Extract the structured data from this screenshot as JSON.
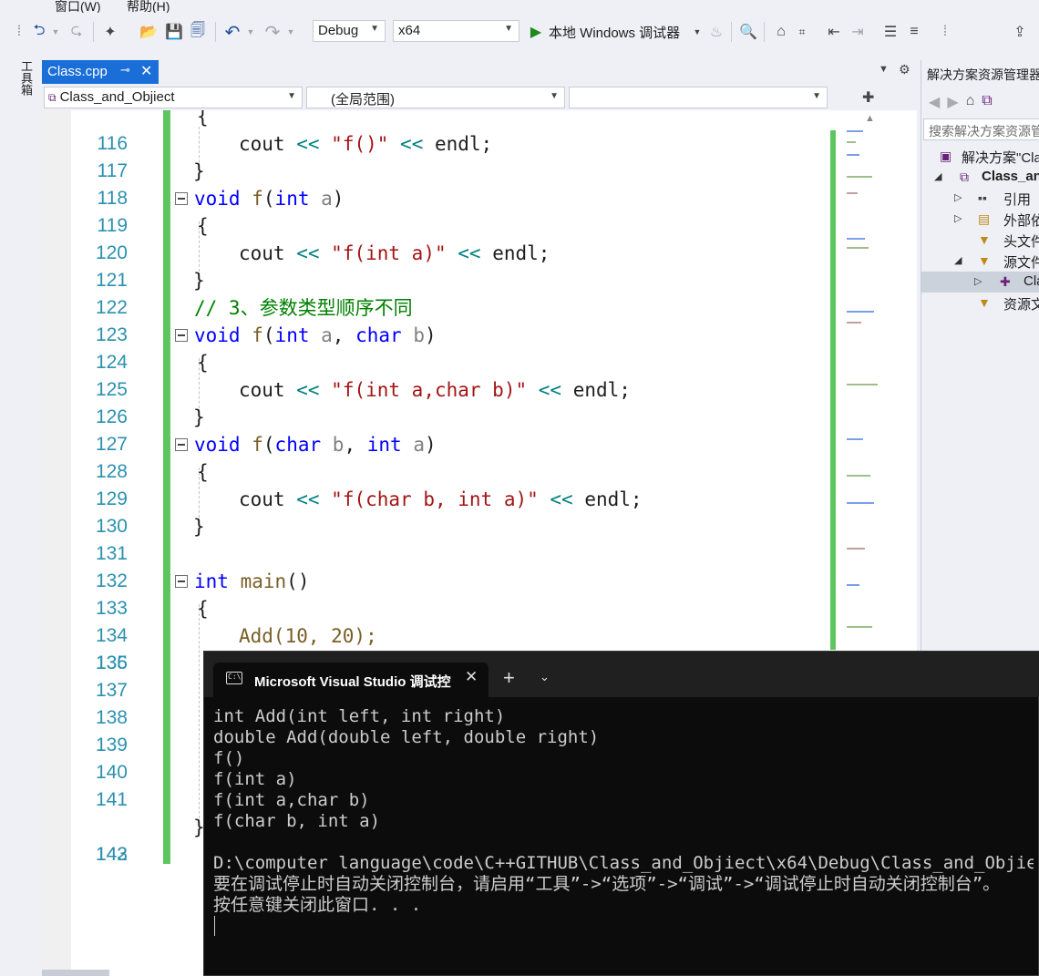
{
  "menubar": {
    "items": [
      "窗口(W)",
      "帮助(H)"
    ]
  },
  "toolbar": {
    "config": "Debug",
    "platform": "x64",
    "run_label": "本地 Windows 调试器"
  },
  "toolbox": {
    "label": "工具箱"
  },
  "tabs": [
    {
      "label": "Class.cpp"
    }
  ],
  "navbar": {
    "project": "Class_and_Objiect",
    "scope": "(全局范围)",
    "member": ""
  },
  "editor": {
    "lines": [
      {
        "n": "116",
        "text": "{"
      },
      {
        "n": "117",
        "text": "cout << \"f()\" << endl;"
      },
      {
        "n": "118",
        "text": "}"
      },
      {
        "n": "119",
        "text": "void f(int a)"
      },
      {
        "n": "120",
        "text": "{"
      },
      {
        "n": "121",
        "text": "cout << \"f(int a)\" << endl;"
      },
      {
        "n": "122",
        "text": "}"
      },
      {
        "n": "123",
        "text": "// 3、参数类型顺序不同"
      },
      {
        "n": "124",
        "text": "void f(int a, char b)"
      },
      {
        "n": "125",
        "text": "{"
      },
      {
        "n": "126",
        "text": "cout << \"f(int a,char b)\" << endl;"
      },
      {
        "n": "127",
        "text": "}"
      },
      {
        "n": "128",
        "text": "void f(char b, int a)"
      },
      {
        "n": "129",
        "text": "{"
      },
      {
        "n": "130",
        "text": "cout << \"f(char b, int a)\" << endl;"
      },
      {
        "n": "131",
        "text": "}"
      },
      {
        "n": "132",
        "text": ""
      },
      {
        "n": "133",
        "text": "int main()"
      },
      {
        "n": "134",
        "text": "{"
      },
      {
        "n": "135",
        "text": "Add(10, 20);"
      },
      {
        "n": "136",
        "text": ""
      },
      {
        "n": "137",
        "text": ""
      },
      {
        "n": "138",
        "text": ""
      },
      {
        "n": "139",
        "text": ""
      },
      {
        "n": "140",
        "text": ""
      },
      {
        "n": "141",
        "text": ""
      },
      {
        "n": "142",
        "text": "}"
      },
      {
        "n": "143",
        "text": ""
      }
    ]
  },
  "solution_explorer": {
    "title": "解决方案资源管理器",
    "search_placeholder": "搜索解决方案资源管理器",
    "tree": [
      {
        "label": "解决方案\"Class_and_Objiect\"",
        "icon": "solution-icon"
      },
      {
        "label": "Class_and_Objiect",
        "icon": "project-icon"
      },
      {
        "label": "引用",
        "icon": "references-icon"
      },
      {
        "label": "外部依赖项",
        "icon": "external-deps-icon"
      },
      {
        "label": "头文件",
        "icon": "folder-filter-icon"
      },
      {
        "label": "源文件",
        "icon": "folder-filter-icon"
      },
      {
        "label": "Class.cpp",
        "icon": "cpp-file-icon"
      },
      {
        "label": "资源文件",
        "icon": "folder-filter-icon"
      }
    ]
  },
  "console": {
    "title": "Microsoft Visual Studio 调试控",
    "lines": [
      "int Add(int left, int right)",
      "double Add(double left, double right)",
      "f()",
      "f(int a)",
      "f(int a,char b)",
      "f(char b, int a)",
      "",
      "D:\\computer language\\code\\C++GITHUB\\Class_and_Objiect\\x64\\Debug\\Class_and_Objiect.exe",
      "要在调试停止时自动关闭控制台，请启用“工具”->“选项”->“调试”->“调试停止时自动关闭控制台”。",
      "按任意键关闭此窗口. . ."
    ]
  },
  "colors": {
    "accent": "#1a6ed8",
    "change_bar": "#5ec65e",
    "keyword": "#0000ff",
    "string": "#a31515",
    "comment": "#008000",
    "line_number": "#2b91af"
  }
}
